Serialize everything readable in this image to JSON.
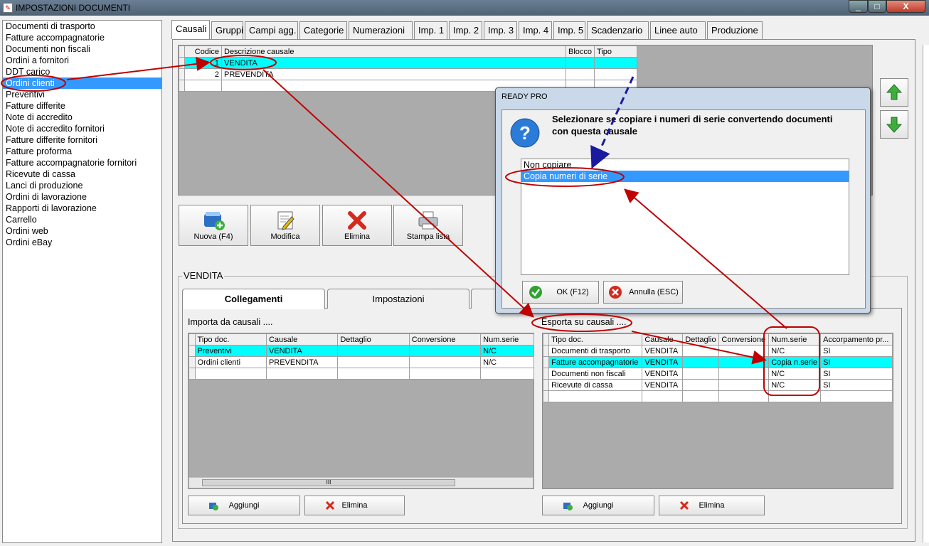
{
  "window": {
    "title": "IMPOSTAZIONI DOCUMENTI",
    "min": "_",
    "max": "□",
    "close": "X"
  },
  "doc_types": [
    "Documenti di trasporto",
    "Fatture accompagnatorie",
    "Documenti non fiscali",
    "Ordini a fornitori",
    "DDT carico",
    "Ordini clienti",
    "Preventivi",
    "Fatture differite",
    "Note di accredito",
    "Note di accredito fornitori",
    "Fatture differite fornitori",
    "Fatture proforma",
    "Fatture accompagnatorie fornitori",
    "Ricevute di cassa",
    "Lanci di produzione",
    "Ordini di lavorazione",
    "Rapporti di lavorazione",
    "Carrello",
    "Ordini web",
    "Ordini eBay"
  ],
  "selected_doc_index": 5,
  "tabs": [
    "Causali",
    "Gruppi",
    "Campi agg.",
    "Categorie",
    "Numerazioni",
    "Imp. 1",
    "Imp. 2",
    "Imp. 3",
    "Imp. 4",
    "Imp. 5",
    "Scadenzario",
    "Linee auto",
    "Produzione"
  ],
  "causali_grid": {
    "headers": [
      "Codice",
      "Descrizione causale",
      "Blocco",
      "Tipo"
    ],
    "rows": [
      [
        "1",
        "VENDITA",
        "",
        ""
      ],
      [
        "2",
        "PREVENDITA",
        "",
        ""
      ]
    ]
  },
  "actions": {
    "new": "Nuova (F4)",
    "edit": "Modifica",
    "delete": "Elimina",
    "print": "Stampa lista"
  },
  "group_label": "VENDITA",
  "subtabs": [
    "Collegamenti",
    "Impostazioni"
  ],
  "import": {
    "label": "Importa da causali ....",
    "headers": [
      "Tipo doc.",
      "Causale",
      "Dettaglio",
      "Conversione",
      "Num.serie"
    ],
    "rows": [
      [
        "Preventivi",
        "VENDITA",
        "",
        "",
        "N/C"
      ],
      [
        "Ordini clienti",
        "PREVENDITA",
        "",
        "",
        "N/C"
      ]
    ],
    "scroll_grip": "III",
    "add": "Aggiungi",
    "delete": "Elimina"
  },
  "export": {
    "label": "Esporta su causali ....",
    "headers": [
      "Tipo doc.",
      "Causale",
      "Dettaglio",
      "Conversione",
      "Num.serie",
      "Accorpamento pr..."
    ],
    "rows": [
      [
        "Documenti di trasporto",
        "VENDITA",
        "",
        "",
        "N/C",
        "SI"
      ],
      [
        "Fatture accompagnatorie",
        "VENDITA",
        "",
        "",
        "Copia n.serie",
        "SI"
      ],
      [
        "Documenti non fiscali",
        "VENDITA",
        "",
        "",
        "N/C",
        "SI"
      ],
      [
        "Ricevute di cassa",
        "VENDITA",
        "",
        "",
        "N/C",
        "SI"
      ]
    ],
    "add": "Aggiungi",
    "delete": "Elimina"
  },
  "dialog": {
    "title": "READY PRO",
    "message": "Selezionare se copiare i numeri di serie convertendo documenti con questa causale",
    "options": [
      "Non copiare",
      "Copia numeri di serie"
    ],
    "selected_option": 1,
    "ok": "OK (F12)",
    "cancel": "Annulla (ESC)"
  },
  "colors": {
    "selection": "#3399ff",
    "cyan_row": "#00ffff",
    "annotation": "#c00000",
    "annotation_dashed": "#1a1aa0"
  }
}
